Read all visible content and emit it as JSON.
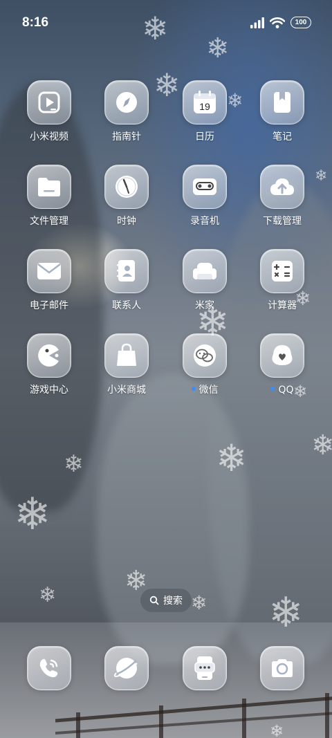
{
  "status_bar": {
    "time": "8:16",
    "battery": "100"
  },
  "apps": [
    {
      "label": "小米视频",
      "icon": "play-icon"
    },
    {
      "label": "指南针",
      "icon": "compass-icon"
    },
    {
      "label": "日历",
      "icon": "calendar-icon",
      "date": "19"
    },
    {
      "label": "笔记",
      "icon": "notebook-icon"
    },
    {
      "label": "文件管理",
      "icon": "folder-icon"
    },
    {
      "label": "时钟",
      "icon": "clock-icon"
    },
    {
      "label": "录音机",
      "icon": "recorder-icon"
    },
    {
      "label": "下载管理",
      "icon": "cloud-download-icon"
    },
    {
      "label": "电子邮件",
      "icon": "mail-icon"
    },
    {
      "label": "联系人",
      "icon": "contacts-icon"
    },
    {
      "label": "米家",
      "icon": "sofa-icon"
    },
    {
      "label": "计算器",
      "icon": "calculator-icon"
    },
    {
      "label": "游戏中心",
      "icon": "game-icon"
    },
    {
      "label": "小米商城",
      "icon": "shopping-bag-icon"
    },
    {
      "label": "微信",
      "icon": "wechat-icon",
      "new_dot": true
    },
    {
      "label": "QQ",
      "icon": "qq-icon",
      "new_dot": true
    }
  ],
  "search": {
    "label": "搜索",
    "icon": "search-icon"
  },
  "dock": [
    {
      "icon": "phone-icon"
    },
    {
      "icon": "browser-icon"
    },
    {
      "icon": "messages-icon"
    },
    {
      "icon": "camera-icon"
    }
  ],
  "colors": {
    "notification_dot": "#3d8bff",
    "icon_glyph": "#ffffff"
  }
}
